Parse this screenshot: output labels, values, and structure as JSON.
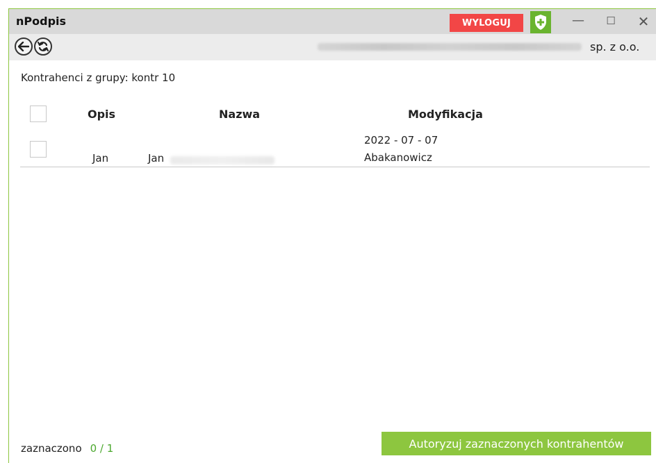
{
  "titlebar": {
    "app_title": "nPodpis",
    "logout_label": "WYLOGUJ",
    "shield_icon": "shield-check-icon",
    "minimize_glyph": "—",
    "maximize_glyph": "☐",
    "close_glyph": "✕"
  },
  "navbar": {
    "back_icon": "arrow-left-icon",
    "refresh_icon": "refresh-icon",
    "company_suffix": "sp. z o.o."
  },
  "group_label": "Kontrahenci z grupy: kontr 10",
  "table": {
    "headers": {
      "opis": "Opis",
      "nazwa": "Nazwa",
      "modyfikacja": "Modyfikacja"
    },
    "rows": [
      {
        "opis": "Jan",
        "nazwa": "Jan",
        "modyfikacja_date": "2022 - 07 - 07",
        "modyfikacja_user": "Abakanowicz"
      }
    ]
  },
  "status": {
    "label": "zaznaczono",
    "count": "0 / 1"
  },
  "actions": {
    "authorize_label": "Autoryzuj zaznaczonych kontrahentów"
  },
  "colors": {
    "accent_green": "#8dc63f",
    "logout_red": "#f24646",
    "count_green": "#4ba82e"
  }
}
